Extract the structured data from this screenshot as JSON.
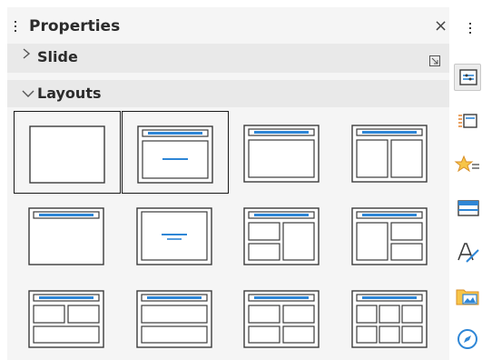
{
  "panel": {
    "title": "Properties",
    "close_glyph": "×",
    "sections": [
      {
        "label": "Slide",
        "expanded": false,
        "chevron": "›"
      },
      {
        "label": "Layouts",
        "expanded": true,
        "chevron": "˅"
      }
    ]
  },
  "layouts": [
    {
      "name": "blank-slide",
      "selected": true
    },
    {
      "name": "title-content",
      "selected": true
    },
    {
      "name": "title-single-content",
      "selected": false
    },
    {
      "name": "title-two-content",
      "selected": false
    },
    {
      "name": "title-only",
      "selected": false
    },
    {
      "name": "centered-text",
      "selected": false
    },
    {
      "name": "title-2-content-and-content",
      "selected": false
    },
    {
      "name": "title-content-and-2-content",
      "selected": false
    },
    {
      "name": "title-2-content-over-content",
      "selected": false
    },
    {
      "name": "title-content-over-content",
      "selected": false
    },
    {
      "name": "title-4-content",
      "selected": false
    },
    {
      "name": "title-6-content",
      "selected": false
    }
  ],
  "sidebar": {
    "icons": [
      "properties-icon",
      "slide-transition-icon",
      "animation-icon",
      "master-slides-icon",
      "styles-icon",
      "gallery-icon",
      "navigator-icon"
    ]
  },
  "colors": {
    "accent": "#2e86d6",
    "frame": "#3b3b3b",
    "panel": "#f5f5f5",
    "section": "#e9e9e9"
  }
}
